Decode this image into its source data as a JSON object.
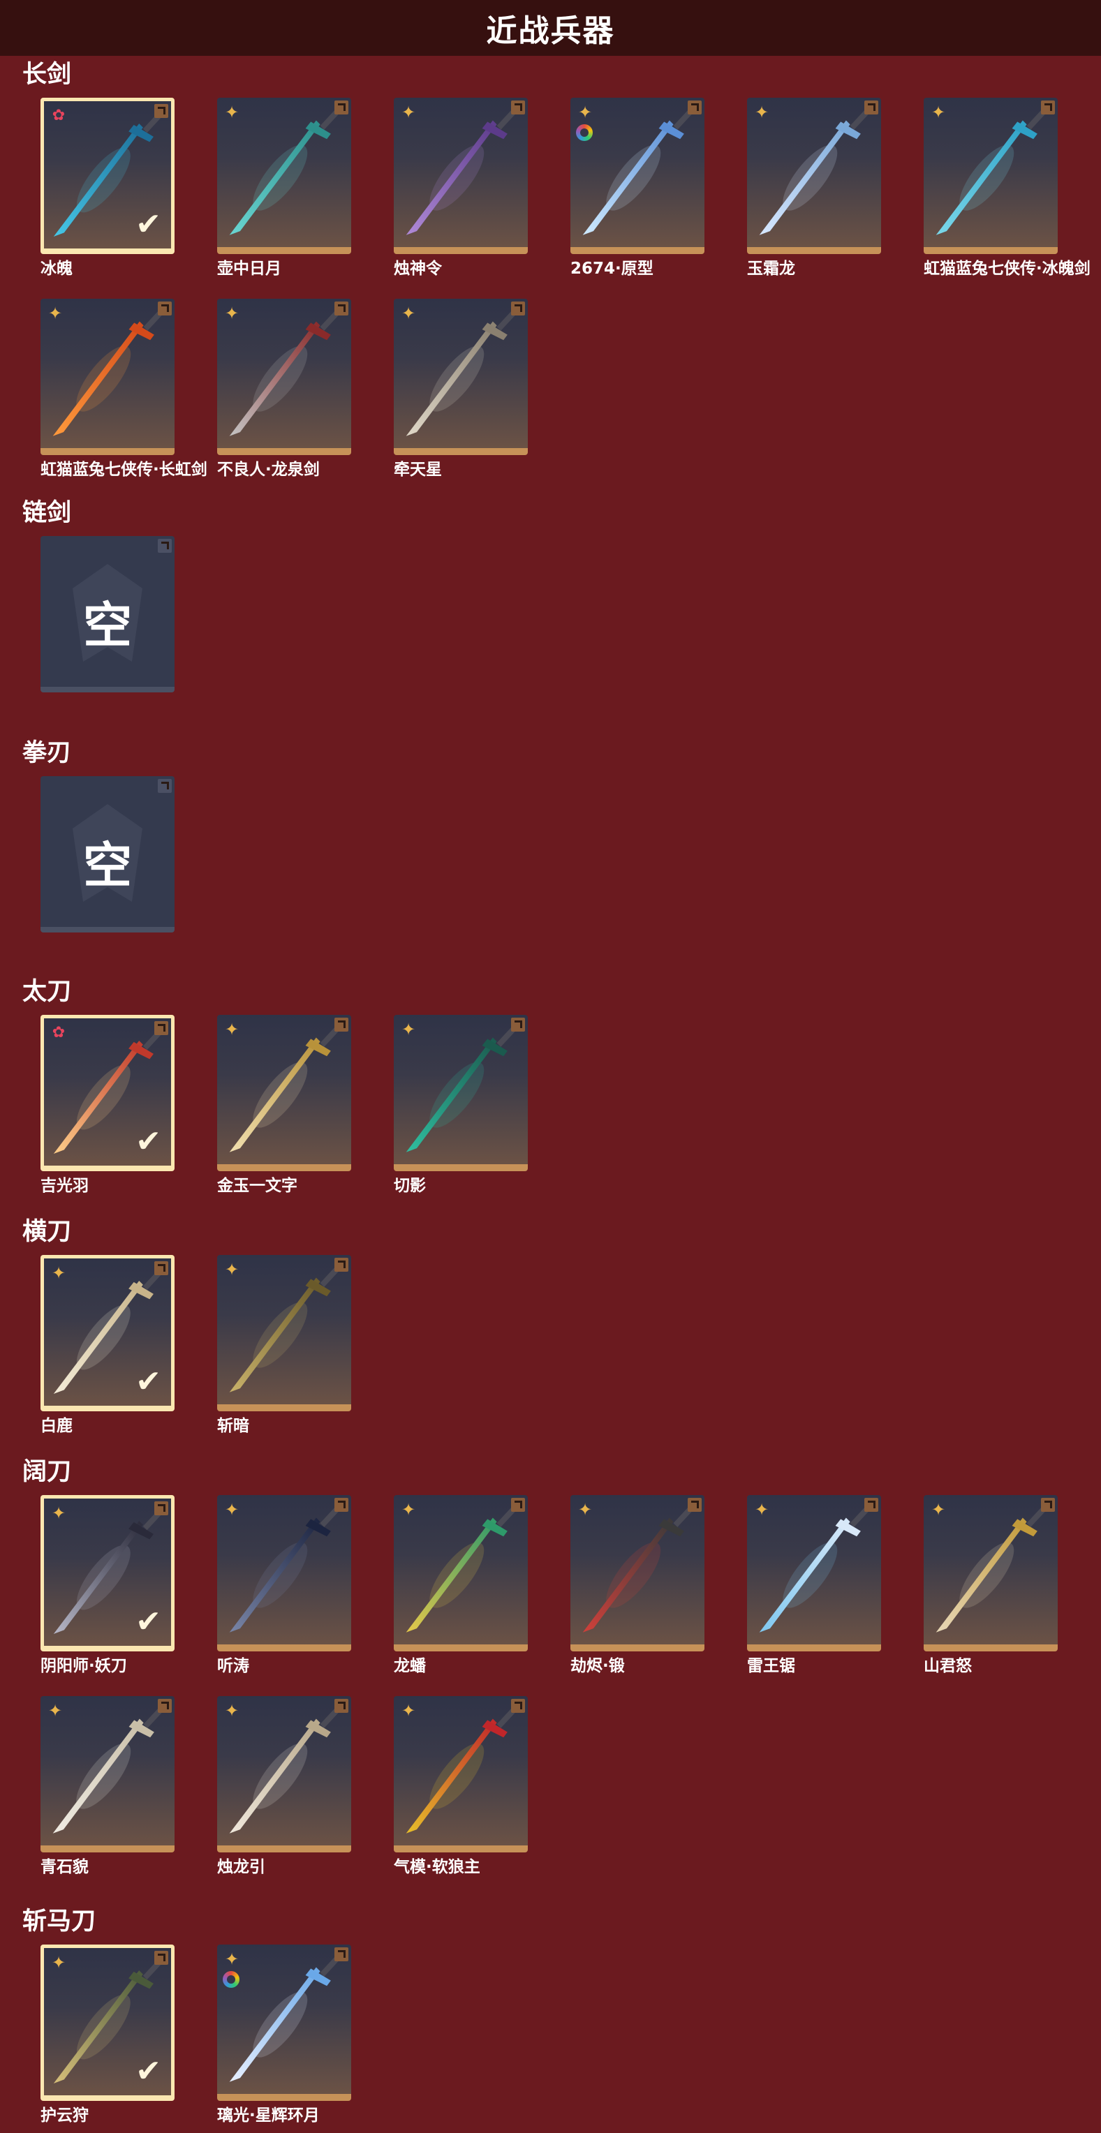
{
  "header": {
    "title": "近战兵器"
  },
  "categories": [
    {
      "name": "长剑",
      "items": [
        {
          "name": "冰魄",
          "rank": "red",
          "equipped": true,
          "colors": [
            "#46c7e6",
            "#1d6f9a"
          ],
          "rainbow": false
        },
        {
          "name": "壶中日月",
          "rank": "gold",
          "equipped": false,
          "colors": [
            "#6ad6d2",
            "#2d8f8c"
          ],
          "rainbow": false
        },
        {
          "name": "烛神令",
          "rank": "gold",
          "equipped": false,
          "colors": [
            "#b08ad8",
            "#5c3b8a"
          ],
          "rainbow": false
        },
        {
          "name": "2674·原型",
          "rank": "gold",
          "equipped": false,
          "colors": [
            "#cfeaff",
            "#5b8fd6"
          ],
          "rainbow": true
        },
        {
          "name": "玉霜龙",
          "rank": "gold",
          "equipped": false,
          "colors": [
            "#d8e8ff",
            "#7aa8d8"
          ],
          "rainbow": false
        },
        {
          "name": "虹猫蓝兔七侠传·冰魄剑",
          "rank": "gold",
          "equipped": false,
          "colors": [
            "#7bd8ea",
            "#2ea1c6"
          ],
          "rainbow": false
        },
        {
          "name": "虹猫蓝兔七侠传·长虹剑",
          "rank": "gold",
          "equipped": false,
          "colors": [
            "#ff9a3c",
            "#d44a1a"
          ],
          "rainbow": false
        },
        {
          "name": "不良人·龙泉剑",
          "rank": "gold",
          "equipped": false,
          "colors": [
            "#c4c4c4",
            "#8a2a2a"
          ],
          "rainbow": false
        },
        {
          "name": "牵天星",
          "rank": "gold",
          "equipped": false,
          "colors": [
            "#e0d8c8",
            "#8a8070"
          ],
          "rainbow": false
        }
      ]
    },
    {
      "name": "链剑",
      "empty_label": "空",
      "items": []
    },
    {
      "name": "拳刃",
      "empty_label": "空",
      "items": []
    },
    {
      "name": "太刀",
      "items": [
        {
          "name": "吉光羽",
          "rank": "red",
          "equipped": true,
          "colors": [
            "#ffcf8a",
            "#c0392b"
          ],
          "rainbow": false
        },
        {
          "name": "金玉一文字",
          "rank": "gold",
          "equipped": false,
          "colors": [
            "#f2e0b0",
            "#b8923a"
          ],
          "rainbow": false
        },
        {
          "name": "切影",
          "rank": "gold",
          "equipped": false,
          "colors": [
            "#2fbfa0",
            "#1b5a4e"
          ],
          "rainbow": false
        }
      ]
    },
    {
      "name": "横刀",
      "items": [
        {
          "name": "白鹿",
          "rank": "gold",
          "equipped": true,
          "colors": [
            "#f4ecd8",
            "#c8b48a"
          ],
          "rainbow": false
        },
        {
          "name": "斩暗",
          "rank": "gold",
          "equipped": false,
          "colors": [
            "#c9b26a",
            "#6a5a2a"
          ],
          "rainbow": false
        }
      ]
    },
    {
      "name": "阔刀",
      "items": [
        {
          "name": "阴阳师·妖刀",
          "rank": "gold",
          "equipped": true,
          "colors": [
            "#b8b8c8",
            "#2a2a3a"
          ],
          "rainbow": false
        },
        {
          "name": "听涛",
          "rank": "gold",
          "equipped": false,
          "colors": [
            "#7a86a8",
            "#1c2440"
          ],
          "rainbow": false
        },
        {
          "name": "龙蟠",
          "rank": "gold",
          "equipped": false,
          "colors": [
            "#e6c94a",
            "#2e9a6a"
          ],
          "rainbow": false
        },
        {
          "name": "劫烬·锻",
          "rank": "gold",
          "equipped": false,
          "colors": [
            "#d0403a",
            "#3a3a3a"
          ],
          "rainbow": false
        },
        {
          "name": "雷王锯",
          "rank": "gold",
          "equipped": false,
          "colors": [
            "#7fc8f0",
            "#d8e8f8"
          ],
          "rainbow": false
        },
        {
          "name": "山君怒",
          "rank": "gold",
          "equipped": false,
          "colors": [
            "#e8d8b8",
            "#c29a3a"
          ],
          "rainbow": false
        },
        {
          "name": "青石貌",
          "rank": "gold",
          "equipped": false,
          "colors": [
            "#f0ece4",
            "#c9bfa8"
          ],
          "rainbow": false
        },
        {
          "name": "烛龙引",
          "rank": "gold",
          "equipped": false,
          "colors": [
            "#f0e8dc",
            "#b8a88a"
          ],
          "rainbow": false
        },
        {
          "name": "气模·软狼主",
          "rank": "gold",
          "equipped": false,
          "colors": [
            "#e8c02a",
            "#c0262a"
          ],
          "rainbow": false
        }
      ]
    },
    {
      "name": "斩马刀",
      "items": [
        {
          "name": "护云狩",
          "rank": "gold",
          "equipped": true,
          "colors": [
            "#d8c07a",
            "#4a5a3a"
          ],
          "rainbow": false
        },
        {
          "name": "璃光·星辉环月",
          "rank": "gold",
          "equipped": false,
          "colors": [
            "#e8f0ff",
            "#6aa8e8"
          ],
          "rainbow": true
        }
      ]
    }
  ],
  "icons": {
    "gold_rank": "four-point-star-icon",
    "red_rank": "flower-icon",
    "equipped": "checkmark-icon",
    "corner": "corner-tag-icon"
  }
}
